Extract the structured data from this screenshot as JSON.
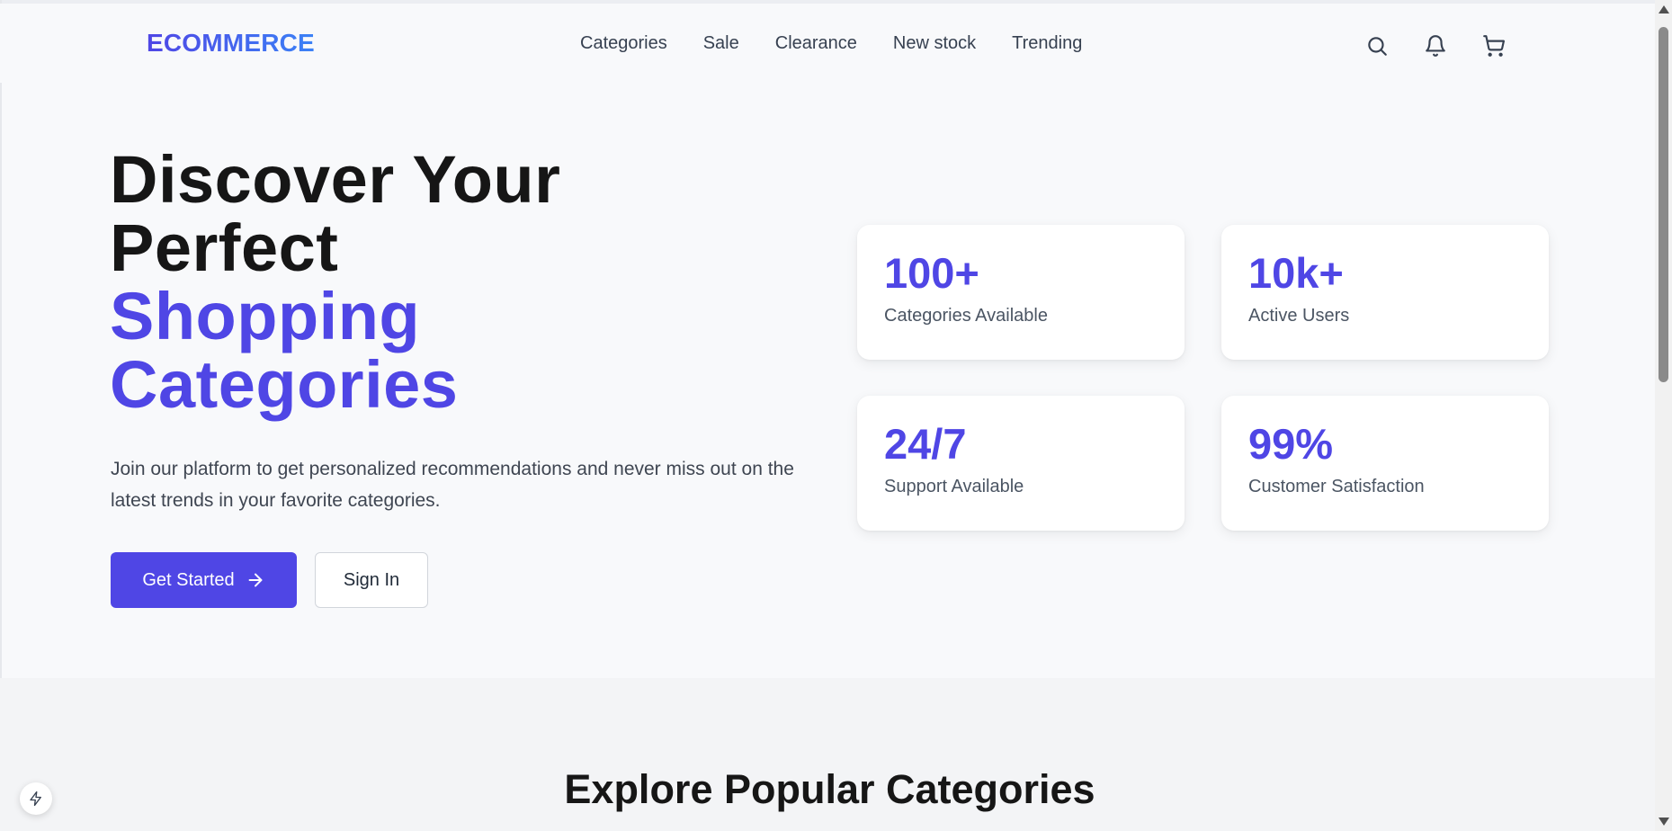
{
  "header": {
    "logo": "ECOMMERCE",
    "nav": [
      "Categories",
      "Sale",
      "Clearance",
      "New stock",
      "Trending"
    ],
    "icons": [
      "search-icon",
      "bell-icon",
      "cart-icon"
    ]
  },
  "hero": {
    "title_line1": "Discover Your",
    "title_line2": "Perfect",
    "title_accent1": "Shopping",
    "title_accent2": "Categories",
    "description": "Join our platform to get personalized recommendations and never miss out on the latest trends in your favorite categories.",
    "primary_button": "Get Started",
    "primary_button_icon": "arrow-right-icon",
    "secondary_button": "Sign In"
  },
  "stats": [
    {
      "value": "100+",
      "label": "Categories Available"
    },
    {
      "value": "10k+",
      "label": "Active Users"
    },
    {
      "value": "24/7",
      "label": "Support Available"
    },
    {
      "value": "99%",
      "label": "Customer Satisfaction"
    }
  ],
  "section2": {
    "title": "Explore Popular Categories"
  },
  "floating_badge_icon": "bolt-icon",
  "colors": {
    "accent": "#4f46e5",
    "background": "#f8f9fb",
    "text_dark": "#161616",
    "text_muted": "#4b5563"
  }
}
